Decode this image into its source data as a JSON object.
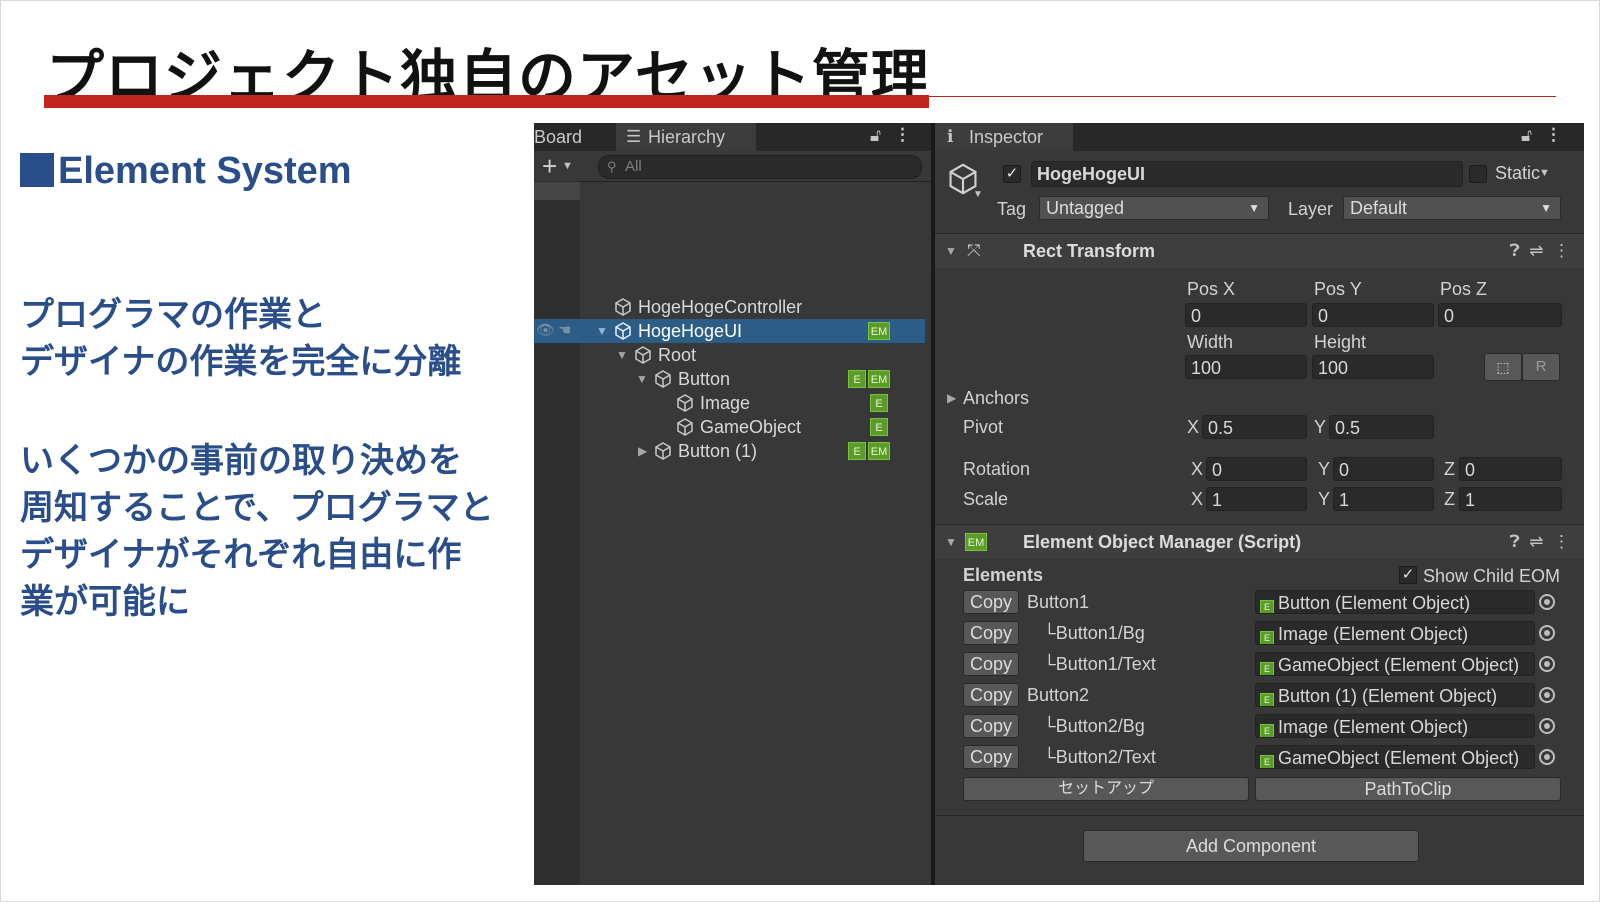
{
  "slide": {
    "title": "プロジェクト独自のアセット管理",
    "section": "Element System",
    "para1": [
      "プログラマの作業と",
      "デザイナの作業を完全に分離"
    ],
    "para2": [
      "いくつかの事前の取り決めを",
      "周知することで、プログラマと",
      "デザイナがそれぞれ自由に作",
      "業が可能に"
    ]
  },
  "colors": {
    "accent_red": "#c0261e",
    "accent_blue": "#2a4e8a",
    "selection": "#2c5d87",
    "badge_green": "#5b9b2a"
  },
  "hierarchy": {
    "tabs": [
      "Board",
      "Hierarchy"
    ],
    "search_placeholder": "All",
    "rows": [
      {
        "name": "HogeHogeController",
        "badges": []
      },
      {
        "name": "HogeHogeUI",
        "badges": [
          "EM"
        ],
        "selected": true
      },
      {
        "name": "Root",
        "badges": []
      },
      {
        "name": "Button",
        "badges": [
          "E",
          "EM"
        ]
      },
      {
        "name": "Image",
        "badges": [
          "E"
        ]
      },
      {
        "name": "GameObject",
        "badges": [
          "E"
        ]
      },
      {
        "name": "Button (1)",
        "badges": [
          "E",
          "EM"
        ]
      }
    ]
  },
  "inspector": {
    "tab": "Inspector",
    "object_name": "HogeHogeUI",
    "static_label": "Static",
    "tag_label": "Tag",
    "tag_value": "Untagged",
    "layer_label": "Layer",
    "layer_value": "Default",
    "rect_transform": {
      "title": "Rect Transform",
      "pos_labels": [
        "Pos X",
        "Pos Y",
        "Pos Z"
      ],
      "pos_values": [
        "0",
        "0",
        "0"
      ],
      "size_labels": [
        "Width",
        "Height"
      ],
      "size_values": [
        "100",
        "100"
      ],
      "r_button": "R",
      "anchors": "Anchors",
      "pivot_label": "Pivot",
      "pivot": {
        "x": "0.5",
        "y": "0.5"
      },
      "rotation_label": "Rotation",
      "rotation": {
        "x": "0",
        "y": "0",
        "z": "0"
      },
      "scale_label": "Scale",
      "scale": {
        "x": "1",
        "y": "1",
        "z": "1"
      },
      "axis": {
        "x": "X",
        "y": "Y",
        "z": "Z"
      }
    },
    "eom": {
      "icon": "EM",
      "title": "Element Object Manager (Script)",
      "elements_label": "Elements",
      "show_child_label": "Show Child EOM",
      "copy_label": "Copy",
      "rows": [
        {
          "path": "Button1",
          "ref": "Button (Element Object)"
        },
        {
          "path": "└Button1/Bg",
          "ref": "Image (Element Object)"
        },
        {
          "path": "└Button1/Text",
          "ref": "GameObject (Element Object)"
        },
        {
          "path": "Button2",
          "ref": "Button (1) (Element Object)"
        },
        {
          "path": "└Button2/Bg",
          "ref": "Image (Element Object)"
        },
        {
          "path": "└Button2/Text",
          "ref": "GameObject (Element Object)"
        }
      ],
      "setup_button": "セットアップ",
      "path_button": "PathToClip"
    },
    "add_component": "Add Component"
  }
}
